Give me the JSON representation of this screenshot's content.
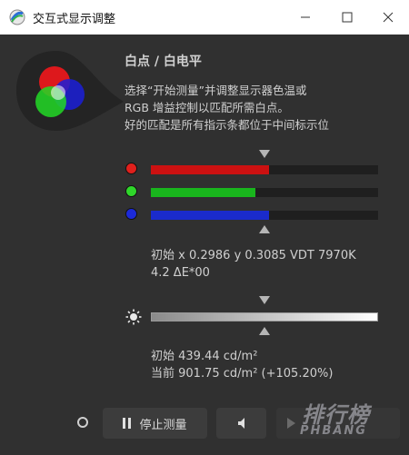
{
  "window": {
    "title": "交互式显示调整",
    "controls": [
      "minimize-icon",
      "maximize-icon",
      "close-icon"
    ]
  },
  "section": {
    "heading": "白点 / 白电平",
    "description": [
      "选择“开始测量”并调整显示器色温或",
      "RGB 增益控制以匹配所需白点。",
      "好的匹配是所有指示条都位于中间标示位"
    ]
  },
  "rgb_bars": [
    {
      "name": "red",
      "color": "#cc1111",
      "dot_color": "#e0201c",
      "level": 0.52
    },
    {
      "name": "green",
      "color": "#19b51d",
      "dot_color": "#2fd62a",
      "level": 0.46
    },
    {
      "name": "blue",
      "color": "#1a2bcc",
      "dot_color": "#1c2ad8",
      "level": 0.52
    }
  ],
  "whitepoint_readout": {
    "line1": "初始 x 0.2986 y 0.3085 VDT 7970K",
    "line2": "4.2 ΔE*00"
  },
  "luminance": {
    "icon": "sun-icon",
    "level": 1.0
  },
  "luminance_readout": {
    "line1": "初始 439.44 cd/m²",
    "line2": "当前 901.75 cd/m² (+105.20%)"
  },
  "footer": {
    "stop_button_label": "停止测量",
    "sound_icon": "speaker-icon",
    "next_icon": "play-icon"
  },
  "watermark": {
    "cn": "排行榜",
    "en": "PHBANG"
  }
}
